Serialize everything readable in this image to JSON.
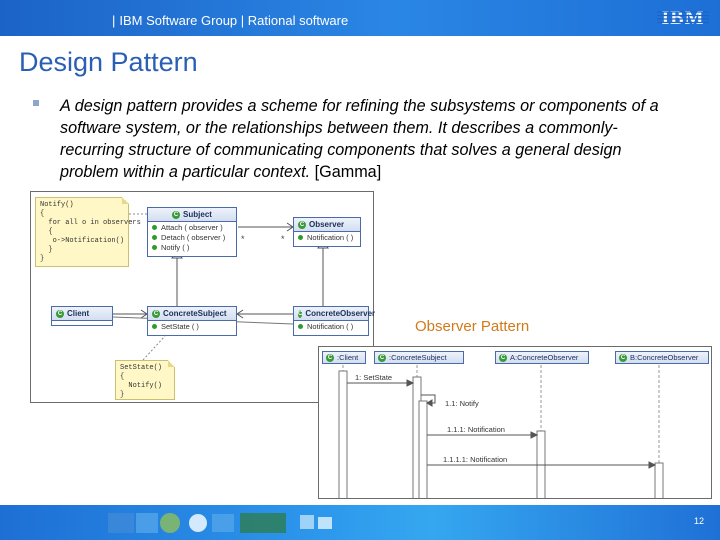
{
  "header": {
    "separator": "|",
    "text": "IBM Software Group | Rational software",
    "logo_text": "IBM"
  },
  "slide": {
    "title": "Design Pattern",
    "bullet_italic": "A design pattern provides a scheme for refining the subsystems or components of a software system, or the relationships between them. It describes a commonly-recurring structure of communicating components that solves a general design problem within a particular context.",
    "bullet_citation": "[Gamma]",
    "caption": "Observer Pattern",
    "page_number": "12"
  },
  "class_diagram": {
    "notify_note": "Notify()\n{\n  for all o in observers\n  {\n   o->Notification()\n  }\n}",
    "setstate_note": "SetState()\n{\n  Notify()\n}",
    "subject": {
      "name": "Subject",
      "ops": [
        "Attach ( observer )",
        "Detach ( observer )",
        "Notify ( )"
      ]
    },
    "observer": {
      "name": "Observer",
      "ops": [
        "Notification ( )"
      ]
    },
    "client": {
      "name": "Client"
    },
    "concrete_subject": {
      "name": "ConcreteSubject",
      "ops": [
        "SetState ( )"
      ]
    },
    "concrete_observer": {
      "name": "ConcreteObserver",
      "ops": [
        "Notification ( )"
      ]
    },
    "multiplicity_left": "*",
    "multiplicity_right": "*"
  },
  "sequence_diagram": {
    "lifelines": [
      ":Client",
      ":ConcreteSubject",
      "A:ConcreteObserver",
      "B:ConcreteObserver"
    ],
    "messages": [
      "1: SetState",
      "1.1: Notify",
      "1.1.1: Notification",
      "1.1.1.1: Notification"
    ]
  },
  "colors": {
    "header_blue": "#1c63c7",
    "title_blue": "#2a5fb4",
    "caption_orange": "#d27a1a",
    "note_yellow": "#fff8c6"
  }
}
